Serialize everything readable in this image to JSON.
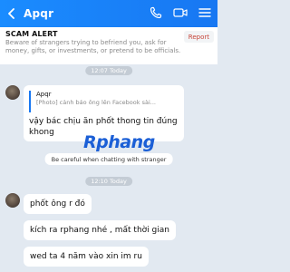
{
  "header": {
    "title": "Apqr",
    "icons": [
      "chevron-left-icon",
      "phone-icon",
      "video-icon",
      "menu-icon"
    ],
    "accent": "#1877f2"
  },
  "scam_alert": {
    "title": "SCAM ALERT",
    "text": "Beware of strangers trying to befriend you, ask for money, gifts, or investments, or pretend to be officials.",
    "report_label": "Report"
  },
  "messages": {
    "time_1": "12:07 Today",
    "quoted": {
      "name": "Apqr",
      "text": "[Photo] cảnh báo ông lên Facebook sài..."
    },
    "reply_text": "vậy bác chịu ăn phốt thong tin đúng khong",
    "watermark": "Rphang",
    "system_notice": "Be careful when chatting with stranger",
    "time_2": "12:10 Today",
    "bubbles": [
      "phốt ông r đó",
      "kích ra rphang nhé , mất thời gian",
      "wed ta 4 năm vào xin im ru"
    ]
  }
}
